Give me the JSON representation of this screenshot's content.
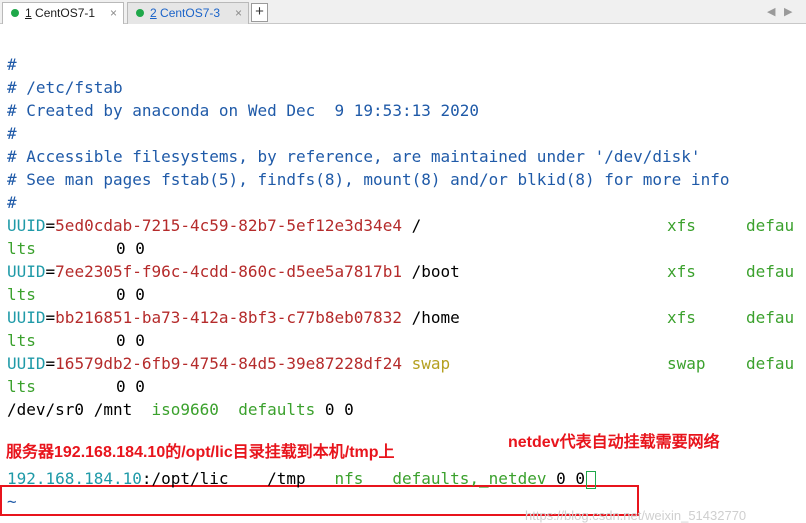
{
  "tabs": [
    {
      "number": "1",
      "name": "CentOS7-1",
      "close": "×"
    },
    {
      "number": "2",
      "name": "CentOS7-3",
      "close": "×"
    }
  ],
  "add_tab": "+",
  "nav": {
    "prev": "◀",
    "next": "▶"
  },
  "lines": [
    {
      "text": "#"
    },
    {
      "text": "# /etc/fstab"
    },
    {
      "text": "# Created by anaconda on Wed Dec  9 19:53:13 2020"
    },
    {
      "text": "#"
    },
    {
      "text": "# Accessible filesystems, by reference, are maintained under '/dev/disk'"
    },
    {
      "text": "# See man pages fstab(5), findfs(8), mount(8) and/or blkid(8) for more info"
    },
    {
      "text": "#"
    }
  ],
  "entries": [
    {
      "key": "UUID",
      "eq": "=",
      "uuid": "5ed0cdab-7215-4c59-82b7-5ef12e3d34e4",
      "mount": "/",
      "fs": "xfs",
      "opts_head": "defau",
      "opts_tail": "lts",
      "dump": "0 0"
    },
    {
      "key": "UUID",
      "eq": "=",
      "uuid": "7ee2305f-f96c-4cdd-860c-d5ee5a7817b1",
      "mount": "/boot",
      "fs": "xfs",
      "opts_head": "defau",
      "opts_tail": "lts",
      "dump": "0 0"
    },
    {
      "key": "UUID",
      "eq": "=",
      "uuid": "bb216851-ba73-412a-8bf3-c77b8eb07832",
      "mount": "/home",
      "fs": "xfs",
      "opts_head": "defau",
      "opts_tail": "lts",
      "dump": "0 0"
    },
    {
      "key": "UUID",
      "eq": "=",
      "uuid": "16579db2-6fb9-4754-84d5-39e87228df24",
      "mount": "swap",
      "fs": "swap",
      "opts_head": "defau",
      "opts_tail": "lts",
      "dump": "0 0"
    }
  ],
  "sr0": {
    "dev": "/dev/sr0",
    "mount": "/mnt",
    "fs": "iso9660",
    "opts": "defaults",
    "dump": "0 0"
  },
  "annotations": {
    "left": "服务器192.168.184.10的/opt/lic目录挂载到本机/tmp上",
    "right": "netdev代表自动挂载需要网络"
  },
  "nfs_line": {
    "ip": "192.168.184.10",
    "colon": ":",
    "path": "/opt/lic",
    "mount": "/tmp",
    "fs": "nfs",
    "opts": "defaults,_netdev",
    "dump": "0 0"
  },
  "tilde": "~",
  "watermark": "https://blog.csdn.net/weixin_51432770",
  "colors": {
    "comment": "#1f5aa8",
    "uuid_value": "#b52b2b",
    "fs_type": "#3ba12d",
    "annotation": "#e8141c",
    "cursor": "#1fa84a"
  }
}
